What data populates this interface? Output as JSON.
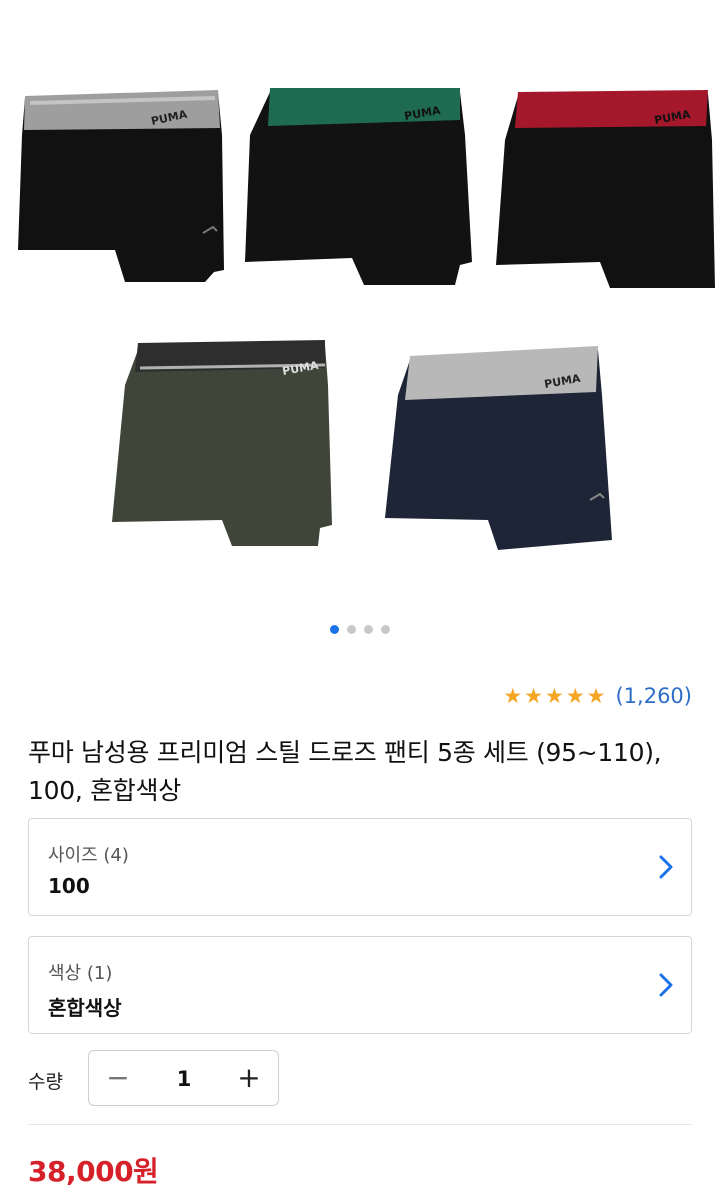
{
  "gallery": {
    "product_image": "boxer-briefs-5-colors-image",
    "band_colors": [
      "#9e9e9e",
      "#1f6b52",
      "#a5182c",
      "#2e2e2e",
      "#b8b8b8"
    ],
    "body_colors": [
      "#111111",
      "#121212",
      "#111111",
      "#3f4639",
      "#1d2536"
    ],
    "brand_text": "PUMA",
    "carousel": {
      "total": 4,
      "active": 1
    }
  },
  "rating": {
    "stars": 5,
    "count_text": "(1,260)"
  },
  "product": {
    "title": "푸마 남성용 프리미엄 스틸 드로즈 팬티 5종 세트 (95~110), 100, 혼합색상"
  },
  "options": {
    "size": {
      "label": "사이즈 (4)",
      "value": "100"
    },
    "color": {
      "label": "색상 (1)",
      "value": "혼합색상"
    }
  },
  "quantity": {
    "label": "수량",
    "value": "1",
    "minus": "−",
    "plus": "+"
  },
  "price": {
    "text": "38,000원",
    "color": "#d6202a"
  }
}
